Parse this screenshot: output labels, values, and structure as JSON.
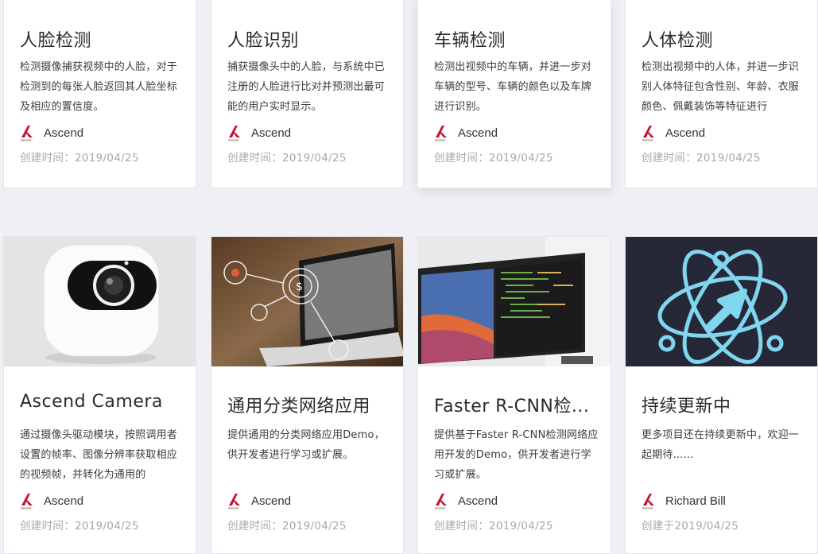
{
  "cards": [
    {
      "title": "人脸检测",
      "desc": "检测摄像捕获视频中的人脸，对于检测到的每张人脸返回其人脸坐标及相应的置信度。",
      "author": "Ascend",
      "date": "创建时间：2019/04/25"
    },
    {
      "title": "人脸识别",
      "desc": "捕获摄像头中的人脸，与系统中已注册的人脸进行比对并预测出最可能的用户实时显示。",
      "author": "Ascend",
      "date": "创建时间：2019/04/25"
    },
    {
      "title": "车辆检测",
      "desc": "检测出视频中的车辆，并进一步对车辆的型号、车辆的颜色以及车牌进行识别。",
      "author": "Ascend",
      "date": "创建时间：2019/04/25"
    },
    {
      "title": "人体检测",
      "desc": "检测出视频中的人体，并进一步识别人体特征包含性别、年龄、衣服颜色、佩戴装饰等特征进行",
      "author": "Ascend",
      "date": "创建时间：2019/04/25"
    },
    {
      "title": "Ascend Camera",
      "desc": "通过摄像头驱动模块，按照调用者设置的帧率、图像分辨率获取相应的视频帧，并转化为通用的",
      "author": "Ascend",
      "date": "创建时间：2019/04/25"
    },
    {
      "title": "通用分类网络应用",
      "desc": "提供通用的分类网络应用Demo，供开发者进行学习或扩展。",
      "author": "Ascend",
      "date": "创建时间：2019/04/25"
    },
    {
      "title": "Faster R-CNN检...",
      "desc": "提供基于Faster R-CNN检测网络应用开发的Demo，供开发者进行学习或扩展。",
      "author": "Ascend",
      "date": "创建时间：2019/04/25"
    },
    {
      "title": "持续更新中",
      "desc": "更多项目还在持续更新中，欢迎一起期待......",
      "author": "Richard Bill",
      "date": "创建于2019/04/25"
    }
  ],
  "icons": {
    "author_logo": "ascend-logo-icon",
    "thumb_camera": "camera-icon",
    "thumb_classify": "laptop-network-icon",
    "thumb_monitor": "monitor-code-icon",
    "thumb_update": "atom-arrow-icon"
  },
  "colors": {
    "page_bg": "#eef0f4",
    "card_bg": "#ffffff",
    "title": "#2b2b2b",
    "date": "#a8a8a8",
    "logo_red": "#c8102e",
    "update_bg": "#262837",
    "update_icon": "#7fd6ee"
  }
}
